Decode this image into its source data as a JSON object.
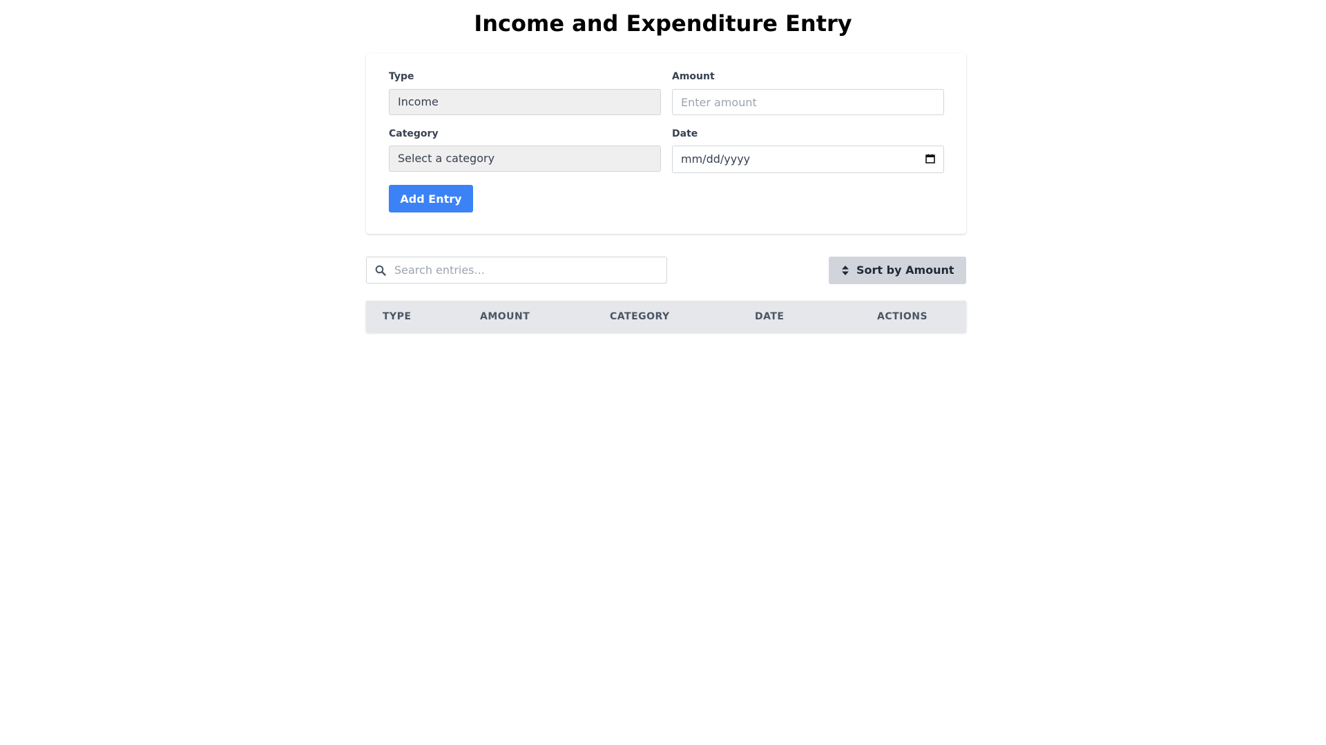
{
  "page": {
    "title": "Income and Expenditure Entry"
  },
  "form": {
    "type_label": "Type",
    "type_value": "Income",
    "amount_label": "Amount",
    "amount_placeholder": "Enter amount",
    "category_label": "Category",
    "category_value": "Select a category",
    "date_label": "Date",
    "date_placeholder": "mm/dd/yyyy",
    "add_button_label": "Add Entry"
  },
  "toolbar": {
    "search_placeholder": "Search entries...",
    "sort_button_label": "Sort by Amount",
    "search_icon": "search-icon",
    "sort_icon": "sort-icon"
  },
  "table": {
    "columns": [
      "TYPE",
      "AMOUNT",
      "CATEGORY",
      "DATE",
      "ACTIONS"
    ],
    "rows": []
  },
  "colors": {
    "primary": "#3b82f6",
    "sort_button_bg": "#d1d5db",
    "table_header_bg": "#e5e7eb"
  }
}
